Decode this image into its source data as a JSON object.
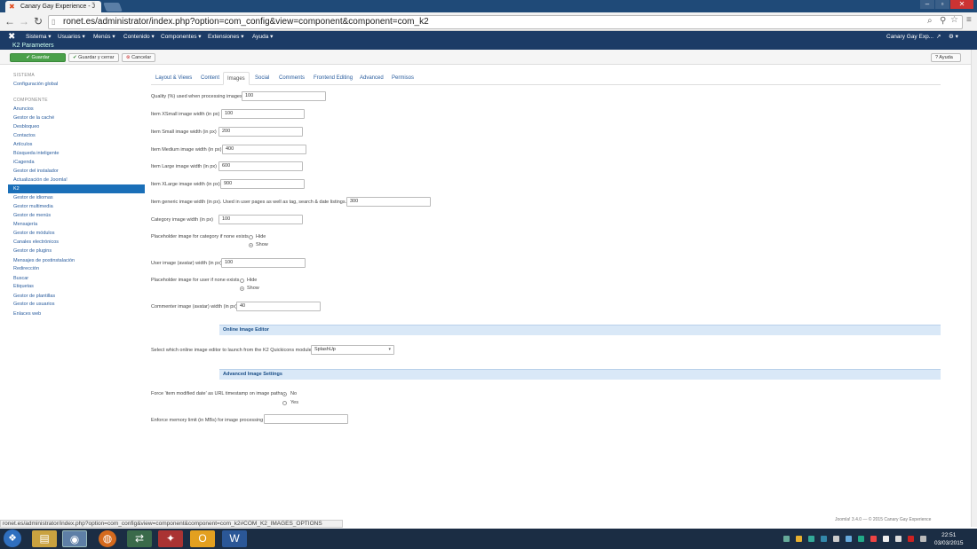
{
  "browser": {
    "tab_title": "Canary Gay Experience - J",
    "url": "ronet.es/administrator/index.php?option=com_config&view=component&component=com_k2",
    "status_url": "ronet.es/administrator/index.php?option=com_config&view=component&component=com_k2#COM_K2_IMAGES_OPTIONS"
  },
  "admin_nav": {
    "items": [
      "Sistema ▾",
      "Usuarios ▾",
      "Menús ▾",
      "Contenido ▾",
      "Componentes ▾",
      "Extensiones ▾",
      "Ayuda ▾"
    ],
    "site_name": "Canary Gay Exp...",
    "subheader_title": "K2 Parameters"
  },
  "actions": {
    "save": "Guardar",
    "save_close": "Guardar y cerrar",
    "cancel": "Cancelar",
    "help": "Ayuda"
  },
  "sidebar": {
    "system_head": "SISTEMA",
    "global_config": "Configuración global",
    "component_head": "COMPONENTE",
    "items": [
      "Anuncios",
      "Gestor de la caché",
      "Desbloqueo",
      "Contactos",
      "Artículos",
      "Búsqueda inteligente",
      "iCagenda",
      "Gestor del instalador",
      "Actualización de Joomla!",
      "K2",
      "Gestor de idiomas",
      "Gestor multimedia",
      "Gestor de menús",
      "Mensajería",
      "Gestor de módulos",
      "Canales electrónicos",
      "Gestor de plugins",
      "Mensajes de postinstalación",
      "Redirección",
      "Buscar",
      "Etiquetas",
      "Gestor de plantillas",
      "Gestor de usuarios",
      "Enlaces web"
    ],
    "active": "K2"
  },
  "tabs": [
    "Layout & Views",
    "Content",
    "Images",
    "Social",
    "Comments",
    "Frontend Editing",
    "Advanced",
    "Permisos"
  ],
  "form": {
    "quality_label": "Quality (%) used when processing images",
    "quality_value": "100",
    "xsmall_label": "Item XSmall image width (in px)",
    "xsmall_value": "100",
    "small_label": "Item Small image width (in px)",
    "small_value": "200",
    "medium_label": "Item Medium image width (in px)",
    "medium_value": "400",
    "large_label": "Item Large image width (in px)",
    "large_value": "600",
    "xlarge_label": "Item XLarge image width (in px)",
    "xlarge_value": "900",
    "generic_label": "Item generic image width (in px). Used in user pages as well as tag, search & date listings.",
    "generic_value": "300",
    "category_label": "Category image width (in px)",
    "category_value": "100",
    "placeholder_cat_label": "Placeholder image for category if none exists",
    "hide": "Hide",
    "show": "Show",
    "user_label": "User image (avatar) width (in px)",
    "user_value": "100",
    "placeholder_user_label": "Placeholder image for user if none exists",
    "commenter_label": "Commenter image (avatar) width (in px)",
    "commenter_value": "40",
    "online_editor_head": "Online Image Editor",
    "editor_label": "Select which online image editor to launch from the K2 Quickicons module",
    "editor_value": "SplashUp",
    "advanced_head": "Advanced Image Settings",
    "force_label": "Force 'item modified date' as URL timestamp on image paths",
    "no": "No",
    "yes": "Yes",
    "memory_label": "Enforce memory limit (in MBs) for image processing",
    "memory_value": ""
  },
  "footer": "Joomla! 3.4.0 — © 2015 Canary Gay Experience",
  "clock": {
    "time": "22:51",
    "date": "03/03/2015"
  }
}
